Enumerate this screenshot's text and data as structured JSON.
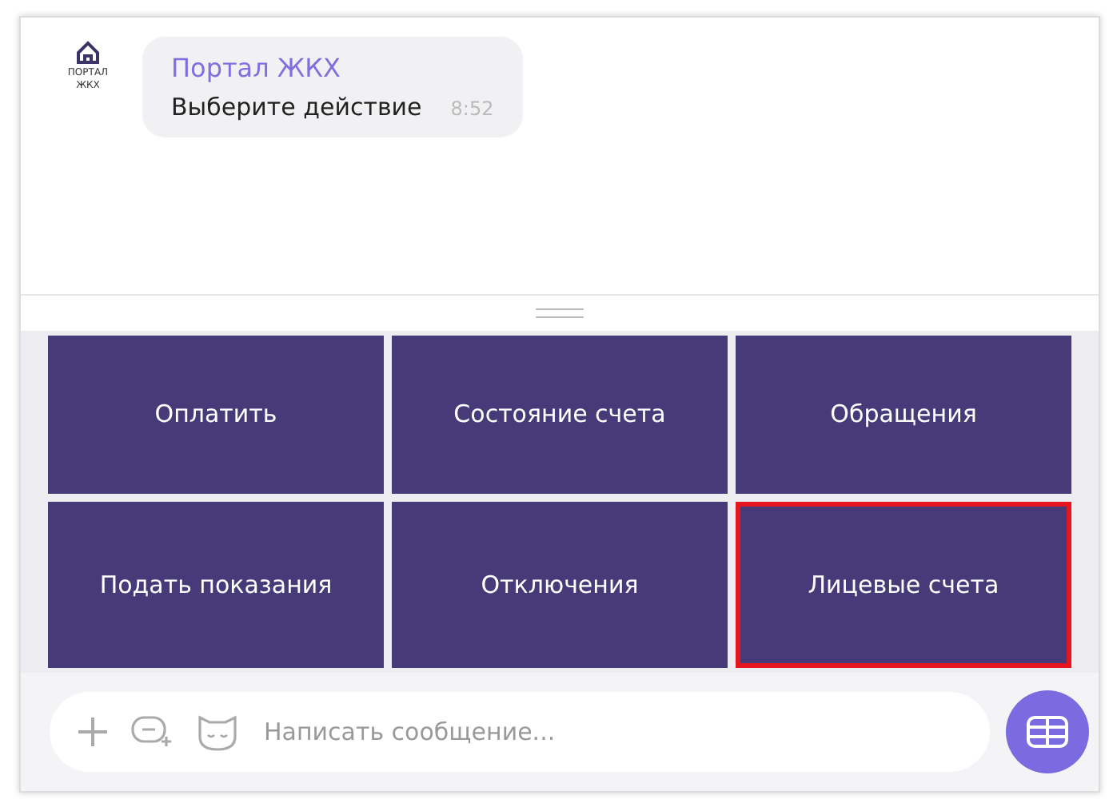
{
  "message": {
    "logo_lines": [
      "ПОРТАЛ",
      "ЖКХ"
    ],
    "sender": "Портал ЖКХ",
    "text": "Выберите действие",
    "time": "8:52"
  },
  "keyboard": [
    {
      "label": "Оплатить",
      "selected": false
    },
    {
      "label": "Состояние счета",
      "selected": false
    },
    {
      "label": "Обращения",
      "selected": false
    },
    {
      "label": "Подать показания",
      "selected": false
    },
    {
      "label": "Отключения",
      "selected": false
    },
    {
      "label": "Лицевые счета",
      "selected": true
    }
  ],
  "composer": {
    "placeholder": "Написать сообщение..."
  }
}
